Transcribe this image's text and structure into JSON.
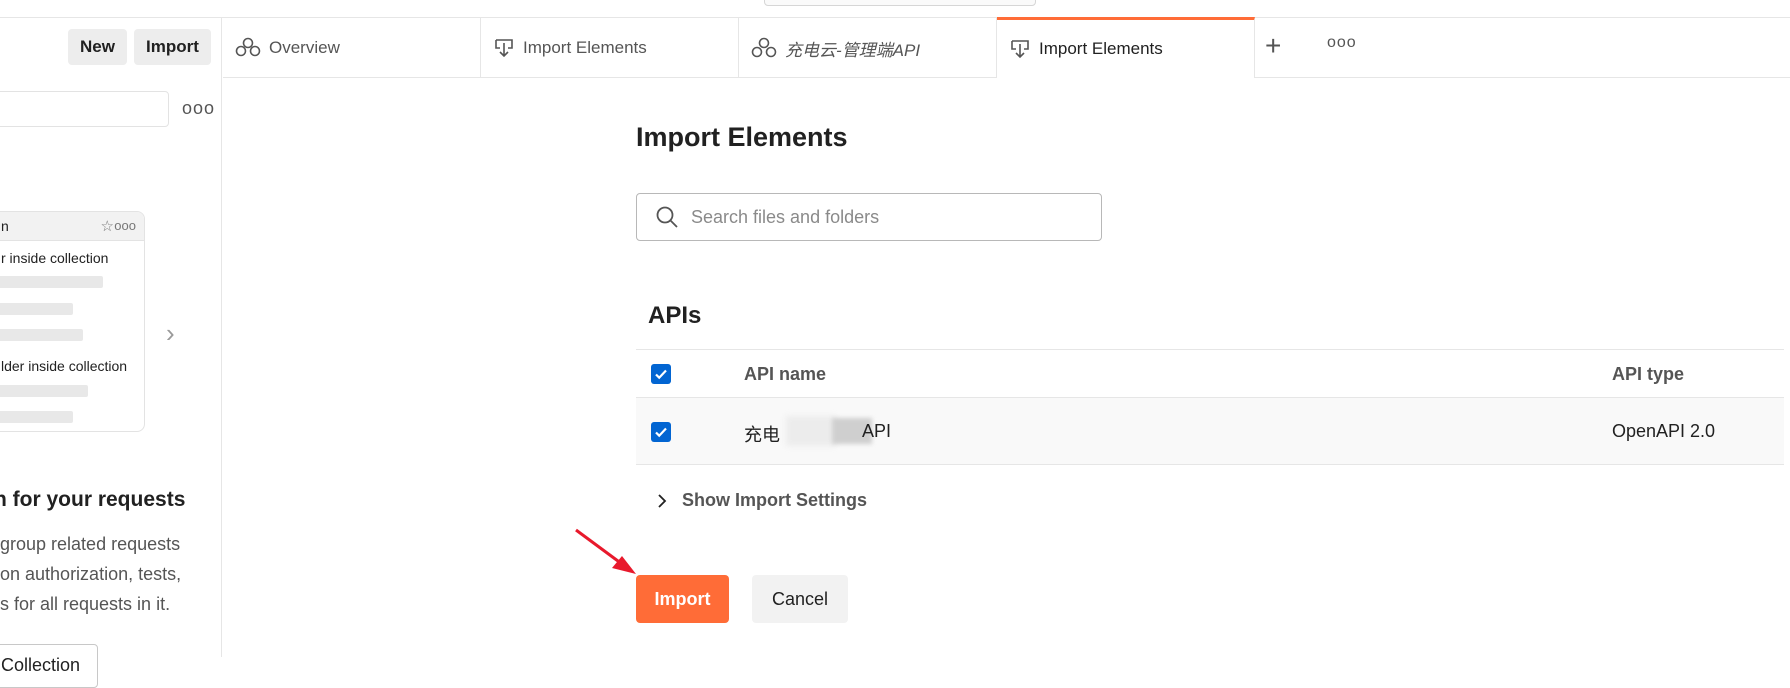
{
  "colors": {
    "accent": "#ff6c37",
    "checkbox": "#0265d2",
    "arrow": "#e8192c"
  },
  "sidebar": {
    "new_label": "New",
    "import_label": "Import",
    "more_icon": "ooo",
    "card": {
      "header": "n",
      "line1": "r inside collection",
      "line2": "lder inside collection"
    },
    "heading": "n for your requests",
    "desc1": "group related requests",
    "desc2": "on authorization, tests,",
    "desc3": "s for all requests in it.",
    "collection_button": "Collection"
  },
  "tabs": [
    {
      "label": "Overview",
      "icon": "team-icon"
    },
    {
      "label": "Import Elements",
      "icon": "import-icon"
    },
    {
      "label": "充电云-管理端API",
      "icon": "api-icon"
    },
    {
      "label": "Import Elements",
      "icon": "import-icon",
      "active": true
    }
  ],
  "tab_more": "ooo",
  "main": {
    "title": "Import Elements",
    "search_placeholder": "Search files and folders",
    "apis_title": "APIs",
    "columns": {
      "name": "API name",
      "type": "API type"
    },
    "rows": [
      {
        "name_visible_start": "充电",
        "name_visible_end": "API",
        "type": "OpenAPI 2.0",
        "checked": true
      }
    ],
    "header_checked": true,
    "show_settings": "Show Import Settings",
    "import_button": "Import",
    "cancel_button": "Cancel"
  }
}
